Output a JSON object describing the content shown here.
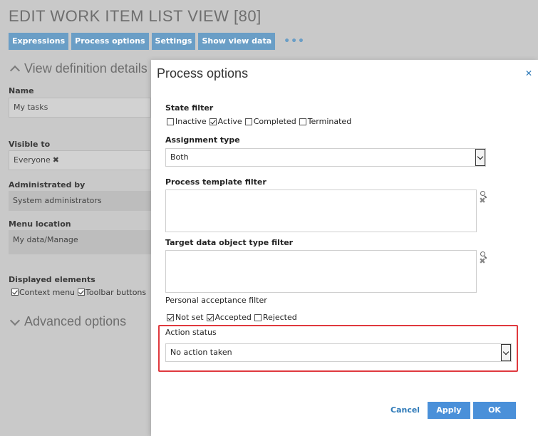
{
  "page": {
    "title": "EDIT WORK ITEM LIST VIEW [80]",
    "toolbar": [
      "Expressions",
      "Process options",
      "Settings",
      "Show view data"
    ],
    "more": "•••"
  },
  "background": {
    "view_definition_details": "View definition details",
    "name_label": "Name",
    "name_value": "My tasks",
    "visible_to_label": "Visible to",
    "visible_to_value": "Everyone",
    "administrated_by_label": "Administrated by",
    "administrated_by_value": "System administrators",
    "menu_location_label": "Menu location",
    "menu_location_value": "My data/Manage",
    "displayed_elements_label": "Displayed elements",
    "displayed_elements": [
      {
        "label": "Context menu",
        "checked": true
      },
      {
        "label": "Toolbar buttons",
        "checked": true
      }
    ],
    "advanced_options": "Advanced options",
    "remove_glyph": "✖"
  },
  "modal": {
    "title": "Process options",
    "close_glyph": "✕",
    "state_filter_label": "State filter",
    "state_filter": [
      {
        "label": "Inactive",
        "checked": false
      },
      {
        "label": "Active",
        "checked": true
      },
      {
        "label": "Completed",
        "checked": false
      },
      {
        "label": "Terminated",
        "checked": false
      }
    ],
    "assignment_type_label": "Assignment type",
    "assignment_type_value": "Both",
    "process_template_filter_label": "Process template filter",
    "target_data_object_type_filter_label": "Target data object type filter",
    "personal_acceptance_filter_label": "Personal acceptance filter",
    "personal_acceptance_filter": [
      {
        "label": "Not set",
        "checked": true
      },
      {
        "label": "Accepted",
        "checked": true
      },
      {
        "label": "Rejected",
        "checked": false
      }
    ],
    "action_status_label": "Action status",
    "action_status_value": "No action taken",
    "clear_glyph": "✖",
    "buttons": {
      "cancel": "Cancel",
      "apply": "Apply",
      "ok": "OK"
    }
  },
  "colors": {
    "accent": "#4a90d9",
    "toolbar": "#6a9ec6",
    "highlight": "#e0393e"
  }
}
